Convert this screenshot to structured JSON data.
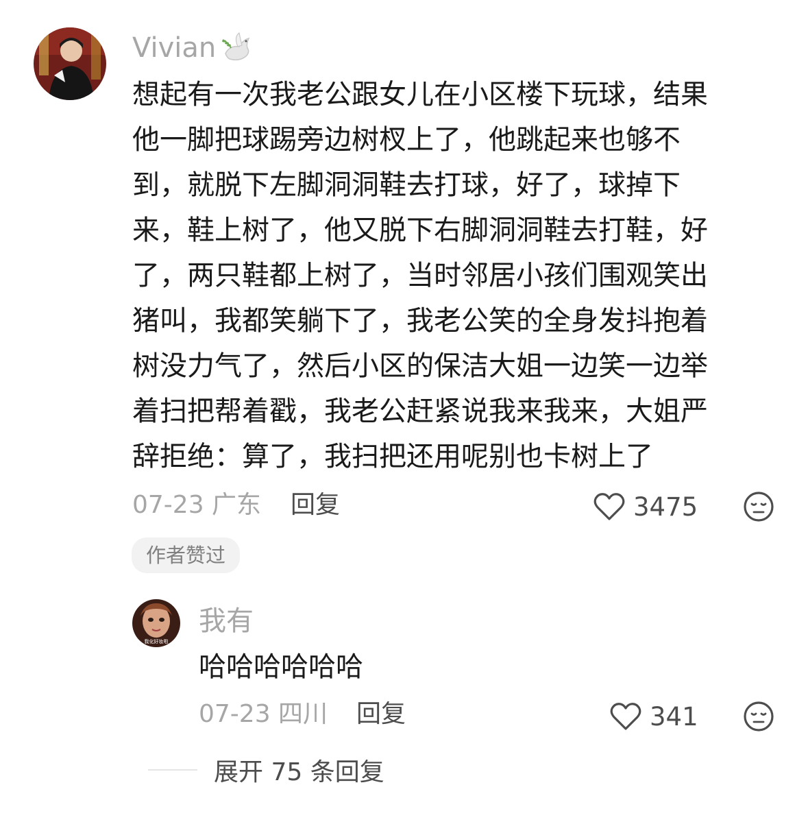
{
  "comment": {
    "username": "Vivian",
    "username_emoji": "dove-with-olive-branch-icon",
    "lines": [
      "想起有一次我老公跟女儿在小区楼下玩球，结果",
      "他一脚把球踢旁边树杈上了，他跳起来也够不",
      "到，就脱下左脚洞洞鞋去打球，好了，球掉下",
      "来，鞋上树了，他又脱下右脚洞洞鞋去打鞋，好",
      "了，两只鞋都上树了，当时邻居小孩们围观笑出",
      "猪叫，我都笑躺下了，我老公笑的全身发抖抱着",
      "树没力气了，然后小区的保洁大姐一边笑一边举",
      "着扫把帮着戳，我老公赶紧说我来我来，大姐严",
      "辞拒绝：算了，我扫把还用呢别也卡树上了"
    ],
    "date_location": "07-23 广东",
    "reply_label": "回复",
    "like_count": "3475",
    "author_liked_badge": "作者赞过"
  },
  "reply": {
    "username": "我有",
    "avatar_caption": "我化好妆啦",
    "text": "哈哈哈哈哈哈",
    "date_location": "07-23 四川",
    "reply_label": "回复",
    "like_count": "341"
  },
  "expand_label": "展开 75 条回复",
  "colors": {
    "username": "#a6a6a6",
    "text": "#1a1a1a",
    "meta": "#a6a6a6",
    "action": "#4d4d4d",
    "badge_bg": "#f2f2f2"
  }
}
